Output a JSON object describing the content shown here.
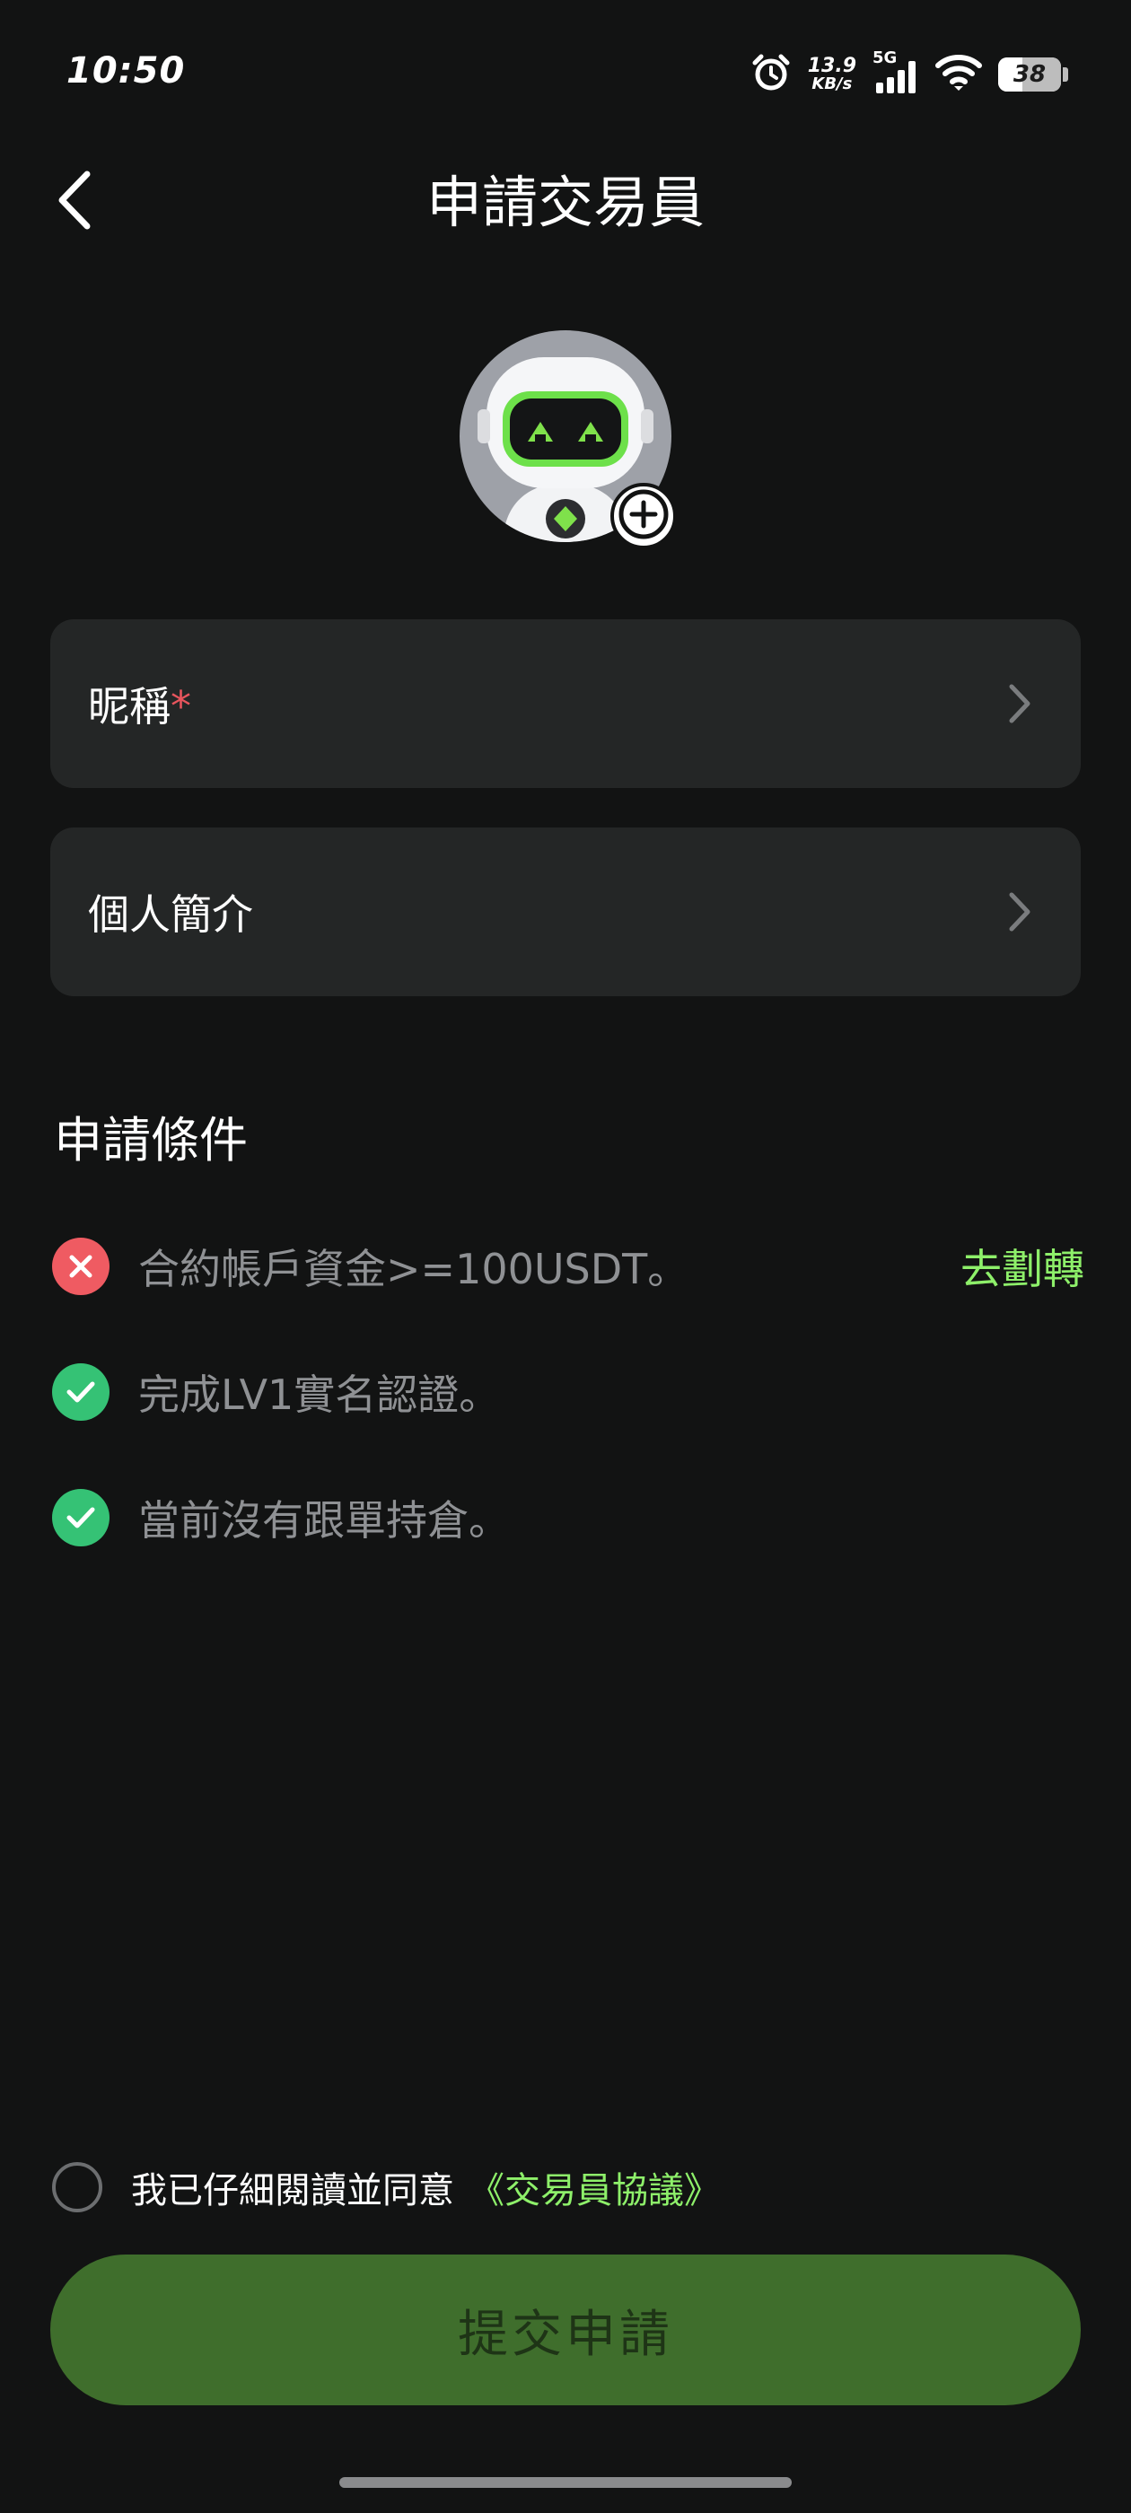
{
  "status_bar": {
    "time": "10:50",
    "net_speed_value": "13.9",
    "net_speed_unit": "KB/s",
    "network": "5G",
    "battery": "38"
  },
  "header": {
    "title": "申請交易員",
    "back_icon": "chevron-left-icon"
  },
  "avatar": {
    "add_icon": "plus-icon"
  },
  "form": {
    "nickname_label": "昵稱",
    "nickname_required_mark": "*",
    "bio_label": "個人簡介"
  },
  "conditions": {
    "title": "申請條件",
    "items": [
      {
        "text": "合約帳戶資金>=100USDT。",
        "status": "unmet",
        "action": "去劃轉"
      },
      {
        "text": "完成LV1實名認證。",
        "status": "met"
      },
      {
        "text": "當前沒有跟單持倉。",
        "status": "met"
      }
    ]
  },
  "agreement": {
    "text": "我已仔細閱讀並同意",
    "link": "《交易員協議》",
    "checked": false
  },
  "submit": {
    "label": "提交申請"
  },
  "colors": {
    "background": "#121313",
    "card": "#242626",
    "accent_green": "#8ef06a",
    "button": "#3f6e2c",
    "error_red": "#ef5b62",
    "success_green": "#35c275"
  }
}
